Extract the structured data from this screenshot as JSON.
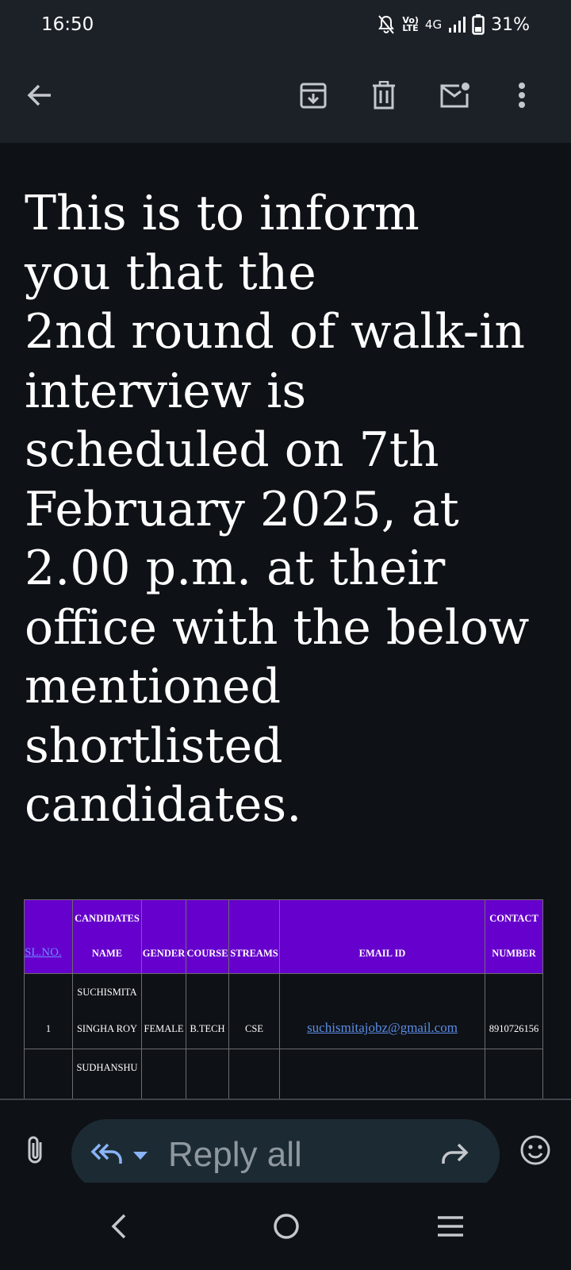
{
  "status_bar": {
    "time": "16:50",
    "network_top": "Vo)",
    "network_bottom": "LTE",
    "network_type": "4G",
    "battery": "31%",
    "icons": [
      "bell-off-icon",
      "volte-icon",
      "signal-icon",
      "battery-icon"
    ]
  },
  "toolbar": {
    "icons": [
      "back-arrow-icon",
      "archive-icon",
      "delete-icon",
      "mark-unread-icon",
      "more-vert-icon"
    ]
  },
  "email": {
    "body_lines": [
      "This is to inform",
      "you that the",
      "2nd round of walk-in",
      "interview is",
      "scheduled on 7th",
      "February 2025, at",
      "2.00 p.m. at their",
      "office with the below",
      "mentioned",
      "shortlisted",
      "candidates."
    ],
    "table": {
      "headers": [
        {
          "line1": "",
          "line2": "SL.NO."
        },
        {
          "line1": "CANDIDATES",
          "line2": "NAME"
        },
        {
          "line1": "",
          "line2": "GENDER"
        },
        {
          "line1": "",
          "line2": "COURSE"
        },
        {
          "line1": "",
          "line2": "STREAMS"
        },
        {
          "line1": "",
          "line2": "EMAIL ID"
        },
        {
          "line1": "CONTACT",
          "line2": "NUMBER"
        }
      ],
      "rows": [
        {
          "sl": "1",
          "name_line1": "SUCHISMITA",
          "name_line2": "SINGHA ROY",
          "gender": "FEMALE",
          "course": "B.TECH",
          "stream": "CSE",
          "email": "suchismitajobz@gmail.com",
          "contact": "8910726156"
        },
        {
          "sl": "",
          "name_line1": "SUDHANSHU",
          "name_line2": "",
          "gender": "",
          "course": "",
          "stream": "",
          "email": "",
          "contact": ""
        }
      ]
    }
  },
  "reply_bar": {
    "label": "Reply all",
    "icons": [
      "attachment-icon",
      "reply-all-icon",
      "dropdown-icon",
      "forward-icon",
      "emoji-icon"
    ]
  },
  "nav_bar": {
    "icons": [
      "nav-back-icon",
      "nav-home-icon",
      "nav-recents-icon"
    ]
  },
  "colors": {
    "header_bg": "#6600cc",
    "surface": "#1c2128",
    "background": "#0e1116",
    "link": "#5b8de6",
    "reply_pill": "#1c2b33",
    "accent_icon": "#8ab4f8"
  }
}
